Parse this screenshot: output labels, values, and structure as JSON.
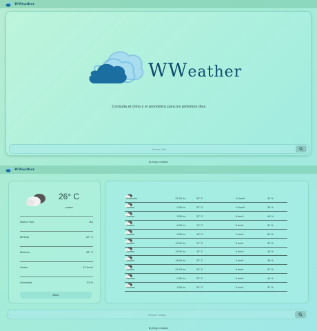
{
  "app": {
    "name": "WWeather",
    "logo_big": "WW",
    "logo_rest": "eather"
  },
  "home": {
    "tagline": "Consulta el clima y el pronóstico para los próximos días.",
    "search_placeholder": "Nueva York",
    "footer": "By Diego Gustavo"
  },
  "detail": {
    "current": {
      "temp": "26° C",
      "desc": "nubes"
    },
    "stats": [
      {
        "label": "Nueva York",
        "value": "NA"
      },
      {
        "label": "Mínimo",
        "value": "22° C"
      },
      {
        "label": "Máximo",
        "value": "26° C"
      },
      {
        "label": "Viento",
        "value": "13 Km/h"
      },
      {
        "label": "Humedad",
        "value": "33 %"
      }
    ],
    "back_label": "Back",
    "forecast": [
      {
        "day": "Miércoles",
        "time": "21:00 hs",
        "temp": "26° C",
        "wind": "14 km/h",
        "hum": "32 %"
      },
      {
        "day": "Jueves",
        "time": "0:00 hs",
        "temp": "22° C",
        "wind": "14 km/h",
        "hum": "36 %"
      },
      {
        "day": "Jueves",
        "time": "3:00 hs",
        "temp": "22° C",
        "wind": "8 km/h",
        "hum": "46 %"
      },
      {
        "day": "Jueves",
        "time": "6:00 hs",
        "temp": "13° C",
        "wind": "5 km/h",
        "hum": "60 %"
      },
      {
        "day": "Jueves",
        "time": "9:00 hs",
        "temp": "16° C",
        "wind": "2 km/h",
        "hum": "63 %"
      },
      {
        "day": "Jueves",
        "time": "12:00 hs",
        "temp": "17° C",
        "wind": "5 km/h",
        "hum": "63 %"
      },
      {
        "day": "Jueves",
        "time": "15:00 hs",
        "temp": "19° C",
        "wind": "5 km/h",
        "hum": "36 %"
      },
      {
        "day": "Jueves",
        "time": "18:00 hs",
        "temp": "23° C",
        "wind": "4 km/h",
        "hum": "38 %"
      },
      {
        "day": "Jueves",
        "time": "21:00 hs",
        "temp": "23° C",
        "wind": "9 km/h",
        "hum": "37 %"
      },
      {
        "day": "Viernes",
        "time": "0:00 hs",
        "temp": "22° C",
        "wind": "9 km/h",
        "hum": "44 %"
      },
      {
        "day": "Viernes",
        "time": "3:00 hs",
        "temp": "20° C",
        "wind": "4 km/h",
        "hum": "37 %"
      }
    ],
    "search_placeholder": "Buscar ciudad",
    "footer": "By Diego Gustavo"
  },
  "colors": {
    "accent": "#0d4d6e",
    "cloud_light": "#8fd3ea",
    "cloud_dark": "#1a6ea0"
  },
  "icons": {
    "logo": "cloud-icon",
    "search": "search-icon",
    "weather": "cloudy-icon"
  }
}
